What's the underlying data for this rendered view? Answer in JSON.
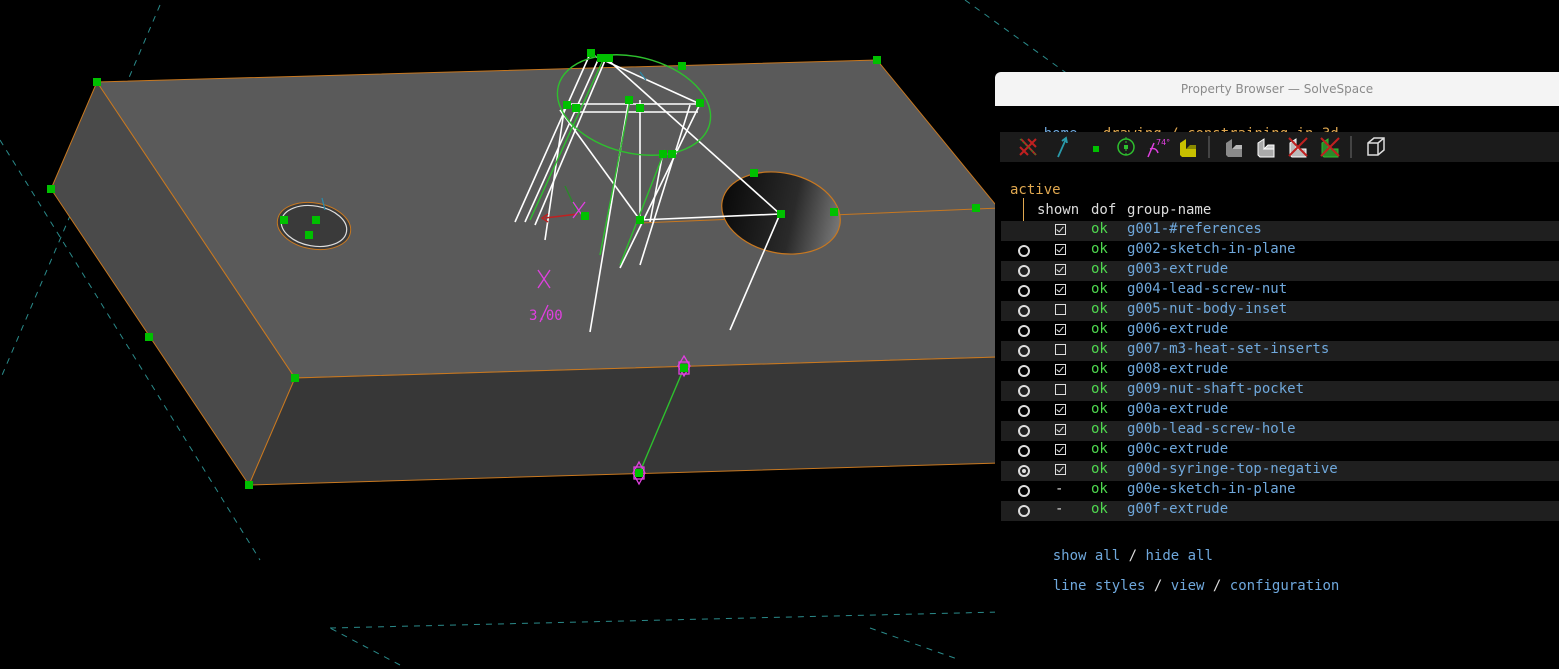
{
  "window": {
    "title": "Property Browser — SolveSpace"
  },
  "nav": {
    "home": "home",
    "breadcrumb": "drawing / constraining in 3d"
  },
  "toolbar": {
    "icons": [
      "construction-toggle-icon",
      "normal-vector-icon",
      "point-icon",
      "workplane-icon",
      "angle-icon",
      "face-icon",
      "solid-shaded-icon",
      "solid-outline-icon",
      "hidden-lines-icon",
      "outline-icon",
      "perspective-icon"
    ]
  },
  "groups": {
    "active_label": "active",
    "headers": {
      "shown": "shown",
      "dof": "dof",
      "name": "group-name"
    },
    "rows": [
      {
        "active": "none",
        "shown": "checked",
        "dof": "ok",
        "name": "g001-#references"
      },
      {
        "active": "off",
        "shown": "checked",
        "dof": "ok",
        "name": "g002-sketch-in-plane"
      },
      {
        "active": "off",
        "shown": "checked",
        "dof": "ok",
        "name": "g003-extrude"
      },
      {
        "active": "off",
        "shown": "checked",
        "dof": "ok",
        "name": "g004-lead-screw-nut"
      },
      {
        "active": "off",
        "shown": "unchecked",
        "dof": "ok",
        "name": "g005-nut-body-inset"
      },
      {
        "active": "off",
        "shown": "checked",
        "dof": "ok",
        "name": "g006-extrude"
      },
      {
        "active": "off",
        "shown": "unchecked",
        "dof": "ok",
        "name": "g007-m3-heat-set-inserts"
      },
      {
        "active": "off",
        "shown": "checked",
        "dof": "ok",
        "name": "g008-extrude"
      },
      {
        "active": "off",
        "shown": "unchecked",
        "dof": "ok",
        "name": "g009-nut-shaft-pocket"
      },
      {
        "active": "off",
        "shown": "checked",
        "dof": "ok",
        "name": "g00a-extrude"
      },
      {
        "active": "off",
        "shown": "checked",
        "dof": "ok",
        "name": "g00b-lead-screw-hole"
      },
      {
        "active": "off",
        "shown": "checked",
        "dof": "ok",
        "name": "g00c-extrude"
      },
      {
        "active": "on",
        "shown": "checked",
        "dof": "ok",
        "name": "g00d-syringe-top-negative"
      },
      {
        "active": "off",
        "shown": "dash",
        "dof": "ok",
        "name": "g00e-sketch-in-plane"
      },
      {
        "active": "off",
        "shown": "dash",
        "dof": "ok",
        "name": "g00f-extrude"
      }
    ],
    "dash_text": "-"
  },
  "links": {
    "show_all": "show all",
    "hide_all": "hide all",
    "line_styles": "line styles",
    "view": "view",
    "configuration": "configuration",
    "slash": "/"
  },
  "viewport": {
    "dimension_label": "3.00"
  },
  "colors": {
    "link": "#6fa8dc",
    "breadcrumb": "#e0a850",
    "dof_ok": "#4fd84f",
    "point": "#00c000",
    "constraint": "#e040e0",
    "edge": "#c87820"
  }
}
